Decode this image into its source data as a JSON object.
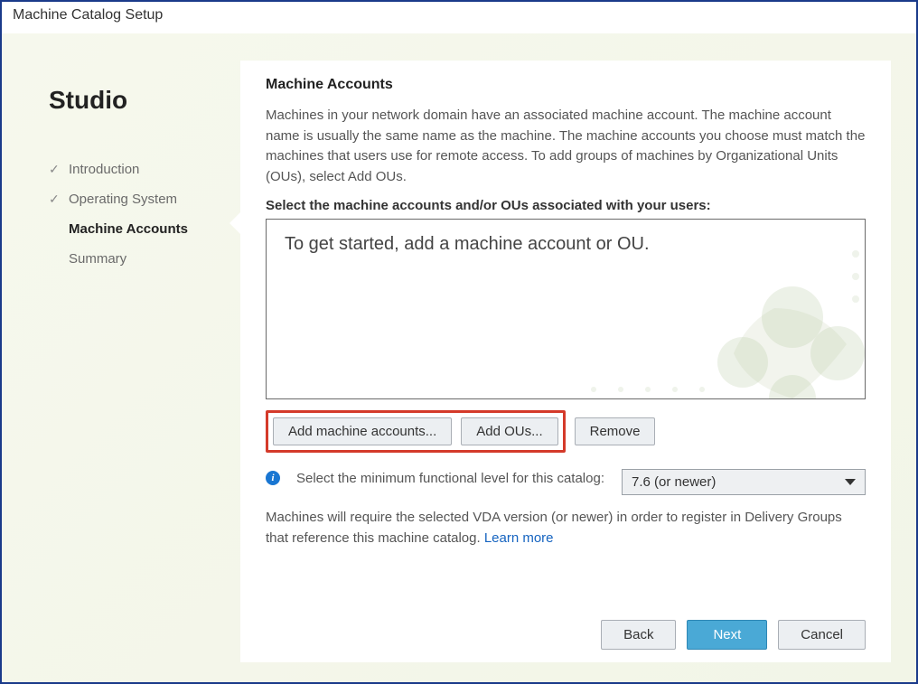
{
  "window": {
    "title": "Machine Catalog Setup"
  },
  "sidebar": {
    "brand": "Studio",
    "steps": [
      {
        "label": "Introduction",
        "state": "done"
      },
      {
        "label": "Operating System",
        "state": "done"
      },
      {
        "label": "Machine Accounts",
        "state": "active"
      },
      {
        "label": "Summary",
        "state": "pending"
      }
    ]
  },
  "main": {
    "heading": "Machine Accounts",
    "intro": "Machines in your network domain have an associated machine account. The machine account name is usually the same name as the machine. The machine accounts you choose must match the machines that users use for remote access. To add groups of machines by Organizational Units (OUs), select Add OUs.",
    "select_label": "Select the machine accounts and/or OUs associated with your users:",
    "listbox_placeholder": "To get started, add a machine account or OU.",
    "buttons": {
      "add_accounts": "Add machine accounts...",
      "add_ous": "Add OUs...",
      "remove": "Remove"
    },
    "functional_level": {
      "label": "Select the minimum functional level for this catalog:",
      "selected": "7.6 (or newer)"
    },
    "note_prefix": "Machines will require the selected VDA version (or newer) in order to register in Delivery Groups that reference this machine catalog. ",
    "learn_more": "Learn more"
  },
  "footer": {
    "back": "Back",
    "next": "Next",
    "cancel": "Cancel"
  }
}
